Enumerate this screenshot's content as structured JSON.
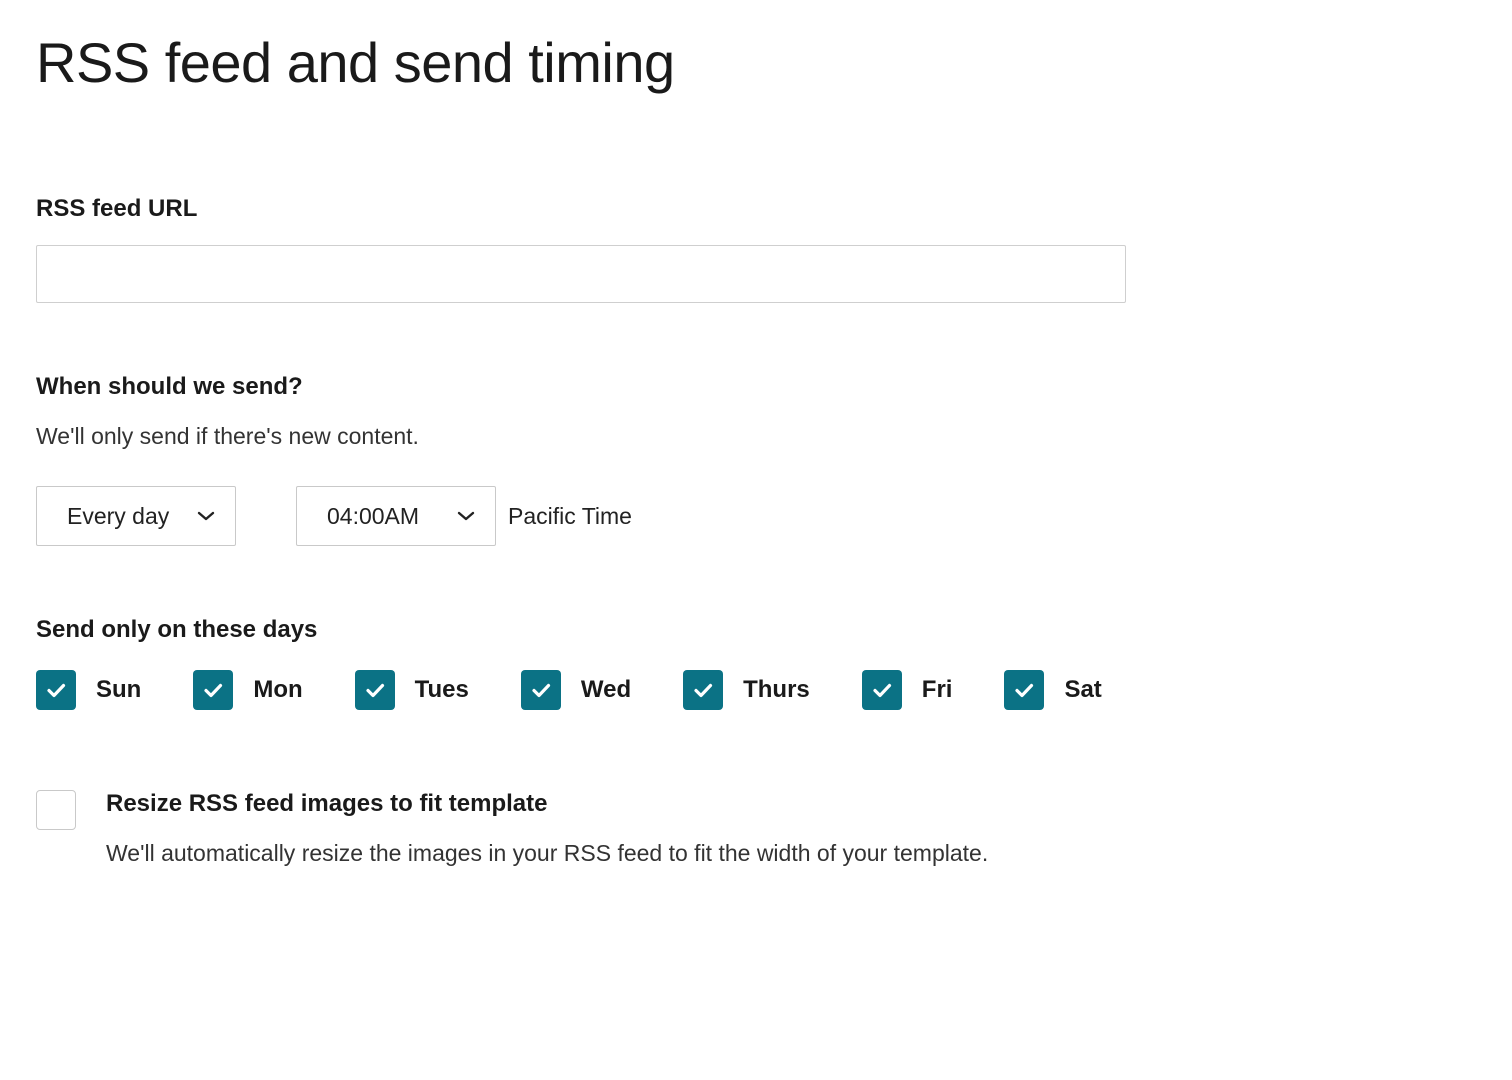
{
  "page": {
    "title": "RSS feed and send timing"
  },
  "rss_url": {
    "label": "RSS feed URL",
    "value": "",
    "placeholder": ""
  },
  "send_timing": {
    "heading": "When should we send?",
    "helper": "We'll only send if there's new content.",
    "frequency_selected": "Every day",
    "time_selected": "04:00AM",
    "timezone": "Pacific Time"
  },
  "days": {
    "heading": "Send only on these days",
    "items": [
      {
        "label": "Sun",
        "checked": true
      },
      {
        "label": "Mon",
        "checked": true
      },
      {
        "label": "Tues",
        "checked": true
      },
      {
        "label": "Wed",
        "checked": true
      },
      {
        "label": "Thurs",
        "checked": true
      },
      {
        "label": "Fri",
        "checked": true
      },
      {
        "label": "Sat",
        "checked": true
      }
    ]
  },
  "resize": {
    "checked": false,
    "title": "Resize RSS feed images to fit template",
    "description": "We'll automatically resize the images in your RSS feed to fit the width of your template."
  },
  "colors": {
    "checkbox_accent": "#0b7285"
  }
}
